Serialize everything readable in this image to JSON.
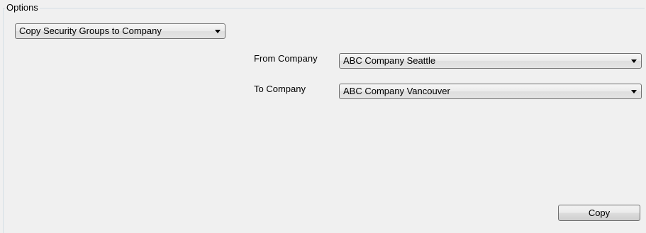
{
  "options_group": {
    "title": "Options"
  },
  "operation_select": {
    "value": "Copy Security Groups to Company"
  },
  "from_company": {
    "label": "From Company",
    "value": "ABC Company Seattle"
  },
  "to_company": {
    "label": "To Company",
    "value": "ABC Company Vancouver"
  },
  "actions": {
    "copy_label": "Copy"
  },
  "icons": {
    "dropdown_arrow": "chevron-down-icon"
  }
}
